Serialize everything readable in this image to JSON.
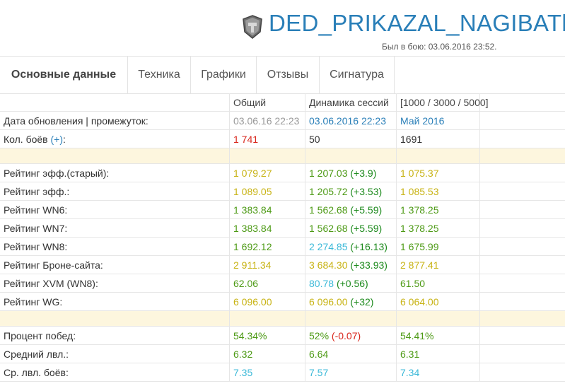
{
  "header": {
    "player_name": "DED_PRIKAZAL_NAGIBATb",
    "last_battle": "Был в бою: 03.06.2016 23:52.",
    "logo_icon": "world-of-tanks-logo-icon"
  },
  "tabs": [
    {
      "label": "Основные данные",
      "active": true
    },
    {
      "label": "Техника"
    },
    {
      "label": "Графики"
    },
    {
      "label": "Отзывы"
    },
    {
      "label": "Сигнатура"
    }
  ],
  "table": {
    "columns": {
      "total": "Общий",
      "session": "Динамика сессий",
      "periods": "[1000 / 3000 / 5000]"
    },
    "update_row": {
      "label": "Дата обновления | промежуток:",
      "total": "03.06.16 22:23",
      "session": "03.06.2016 22:23",
      "month": "Май 2016"
    },
    "battles_row": {
      "label": "Кол. боёв",
      "plus": "(+)",
      "suffix": ":",
      "total": "1 741",
      "session": "50",
      "month": "1691"
    },
    "ratings": [
      {
        "label": "Рейтинг эфф.(старый):",
        "total": "1 079.27",
        "session": "1 207.03",
        "delta": "(+3.9)",
        "month": "1 075.37",
        "c_total": "yellow",
        "c_session": "green",
        "c_month": "yellow"
      },
      {
        "label": "Рейтинг эфф.:",
        "total": "1 089.05",
        "session": "1 205.72",
        "delta": "(+3.53)",
        "month": "1 085.53",
        "c_total": "yellow",
        "c_session": "green",
        "c_month": "yellow"
      },
      {
        "label": "Рейтинг WN6:",
        "total": "1 383.84",
        "session": "1 562.68",
        "delta": "(+5.59)",
        "month": "1 378.25",
        "c_total": "green",
        "c_session": "green",
        "c_month": "green"
      },
      {
        "label": "Рейтинг WN7:",
        "total": "1 383.84",
        "session": "1 562.68",
        "delta": "(+5.59)",
        "month": "1 378.25",
        "c_total": "green",
        "c_session": "green",
        "c_month": "green"
      },
      {
        "label": "Рейтинг WN8:",
        "total": "1 692.12",
        "session": "2 274.85",
        "delta": "(+16.13)",
        "month": "1 675.99",
        "c_total": "green",
        "c_session": "cyan",
        "c_month": "green"
      },
      {
        "label": "Рейтинг Броне-сайта:",
        "total": "2 911.34",
        "session": "3 684.30",
        "delta": "(+33.93)",
        "month": "2 877.41",
        "c_total": "yellow",
        "c_session": "yellow",
        "c_month": "yellow"
      },
      {
        "label": "Рейтинг XVM (WN8):",
        "total": "62.06",
        "session": "80.78",
        "delta": "(+0.56)",
        "month": "61.50",
        "c_total": "green",
        "c_session": "cyan",
        "c_month": "green"
      },
      {
        "label": "Рейтинг WG:",
        "total": "6 096.00",
        "session": "6 096.00",
        "delta": "(+32)",
        "month": "6 064.00",
        "c_total": "yellow",
        "c_session": "yellow",
        "c_month": "yellow"
      }
    ],
    "stats": [
      {
        "label": "Процент побед:",
        "total": "54.34%",
        "session": "52%",
        "delta": "(-0.07)",
        "delta_color": "red",
        "month": "54.41%",
        "c_total": "green",
        "c_session": "green",
        "c_month": "green"
      },
      {
        "label": "Средний лвл.:",
        "total": "6.32",
        "session": "6.64",
        "delta": "",
        "month": "6.31",
        "c_total": "green",
        "c_session": "green",
        "c_month": "green"
      },
      {
        "label": "Ср. лвл. боёв:",
        "total": "7.35",
        "session": "7.57",
        "delta": "",
        "month": "7.34",
        "c_total": "cyan",
        "c_session": "cyan",
        "c_month": "cyan"
      }
    ]
  },
  "colors": {
    "accent_blue": "#2a7fb8",
    "green": "#4d9a15",
    "yellow": "#c8b314",
    "cyan": "#3cb9d8",
    "red": "#d9261c",
    "separator_bg": "#fdf6de"
  }
}
